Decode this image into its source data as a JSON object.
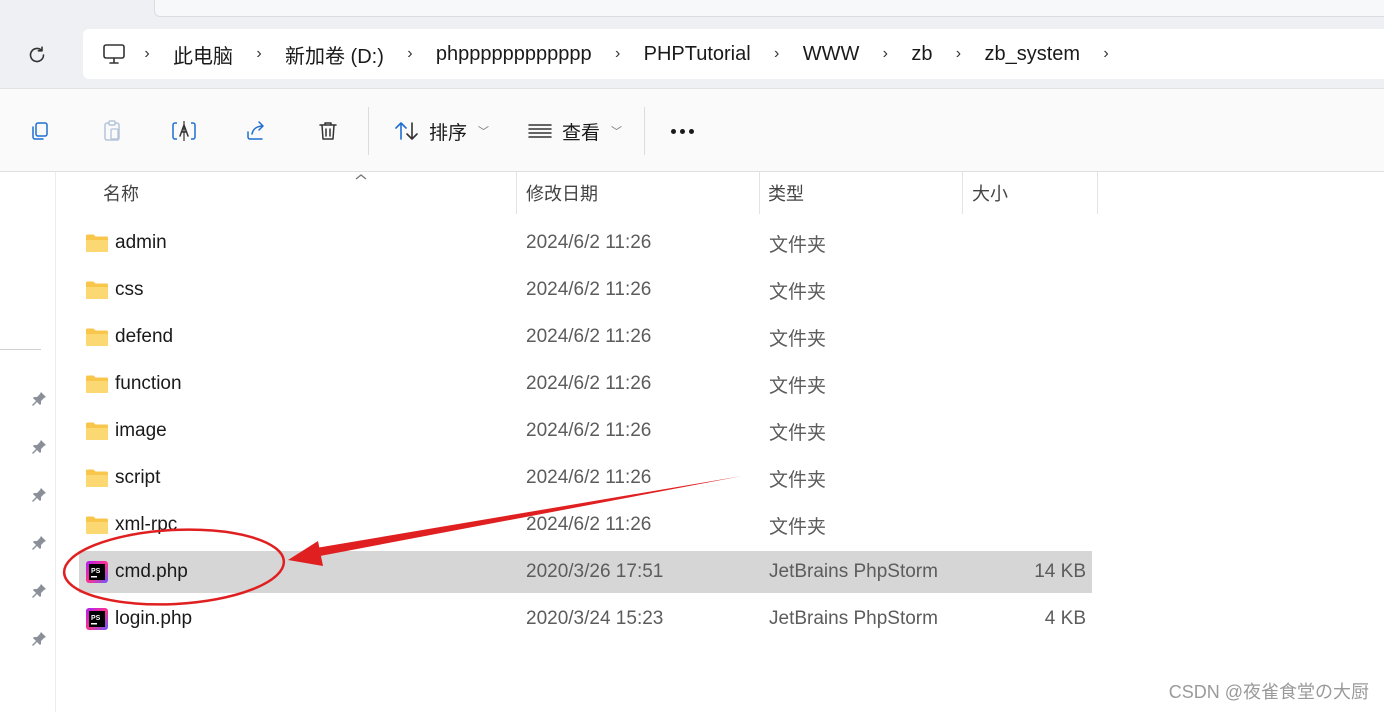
{
  "address": {
    "segments": [
      "此电脑",
      "新加卷 (D:)",
      "phpppppppppppp",
      "PHPTutorial",
      "WWW",
      "zb",
      "zb_system"
    ]
  },
  "toolbar": {
    "sort_label": "排序",
    "view_label": "查看",
    "icons": [
      "copy-icon",
      "paste-icon",
      "rename-icon",
      "share-icon",
      "delete-icon",
      "sort-icon",
      "view-icon",
      "more-icon"
    ]
  },
  "columns": {
    "name": "名称",
    "modified": "修改日期",
    "type": "类型",
    "size": "大小"
  },
  "files": [
    {
      "name": "admin",
      "modified": "2024/6/2 11:26",
      "type": "文件夹",
      "size": "",
      "kind": "folder"
    },
    {
      "name": "css",
      "modified": "2024/6/2 11:26",
      "type": "文件夹",
      "size": "",
      "kind": "folder"
    },
    {
      "name": "defend",
      "modified": "2024/6/2 11:26",
      "type": "文件夹",
      "size": "",
      "kind": "folder"
    },
    {
      "name": "function",
      "modified": "2024/6/2 11:26",
      "type": "文件夹",
      "size": "",
      "kind": "folder"
    },
    {
      "name": "image",
      "modified": "2024/6/2 11:26",
      "type": "文件夹",
      "size": "",
      "kind": "folder"
    },
    {
      "name": "script",
      "modified": "2024/6/2 11:26",
      "type": "文件夹",
      "size": "",
      "kind": "folder"
    },
    {
      "name": "xml-rpc",
      "modified": "2024/6/2 11:26",
      "type": "文件夹",
      "size": "",
      "kind": "folder"
    },
    {
      "name": "cmd.php",
      "modified": "2020/3/26 17:51",
      "type": "JetBrains PhpStorm",
      "size": "14 KB",
      "kind": "php",
      "selected": true
    },
    {
      "name": "login.php",
      "modified": "2020/3/24 15:23",
      "type": "JetBrains PhpStorm",
      "size": "4 KB",
      "kind": "php"
    }
  ],
  "watermark": "CSDN @夜雀食堂の大厨",
  "colors": {
    "folder": "#f8c64a",
    "selection": "#d6d6d6",
    "annotation": "#e02020"
  }
}
